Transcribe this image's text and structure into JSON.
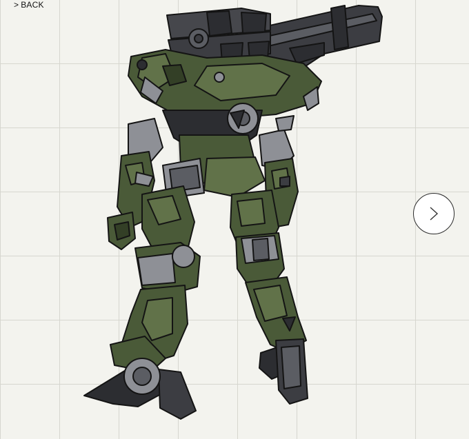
{
  "nav": {
    "back_arrow": ">",
    "back_label": "BACK",
    "next_icon": "chevron-right-icon"
  },
  "figure": {
    "subject_icon": "mecha-back-view-illustration"
  },
  "colors": {
    "background": "#f3f3ee",
    "grid_line": "#d6d6cf",
    "armor_green": "#4a5a38",
    "armor_green_light": "#617249",
    "armor_green_dark": "#333f26",
    "metal_dark": "#3c3d42",
    "metal_grey": "#8e9096",
    "outline": "#141414"
  }
}
